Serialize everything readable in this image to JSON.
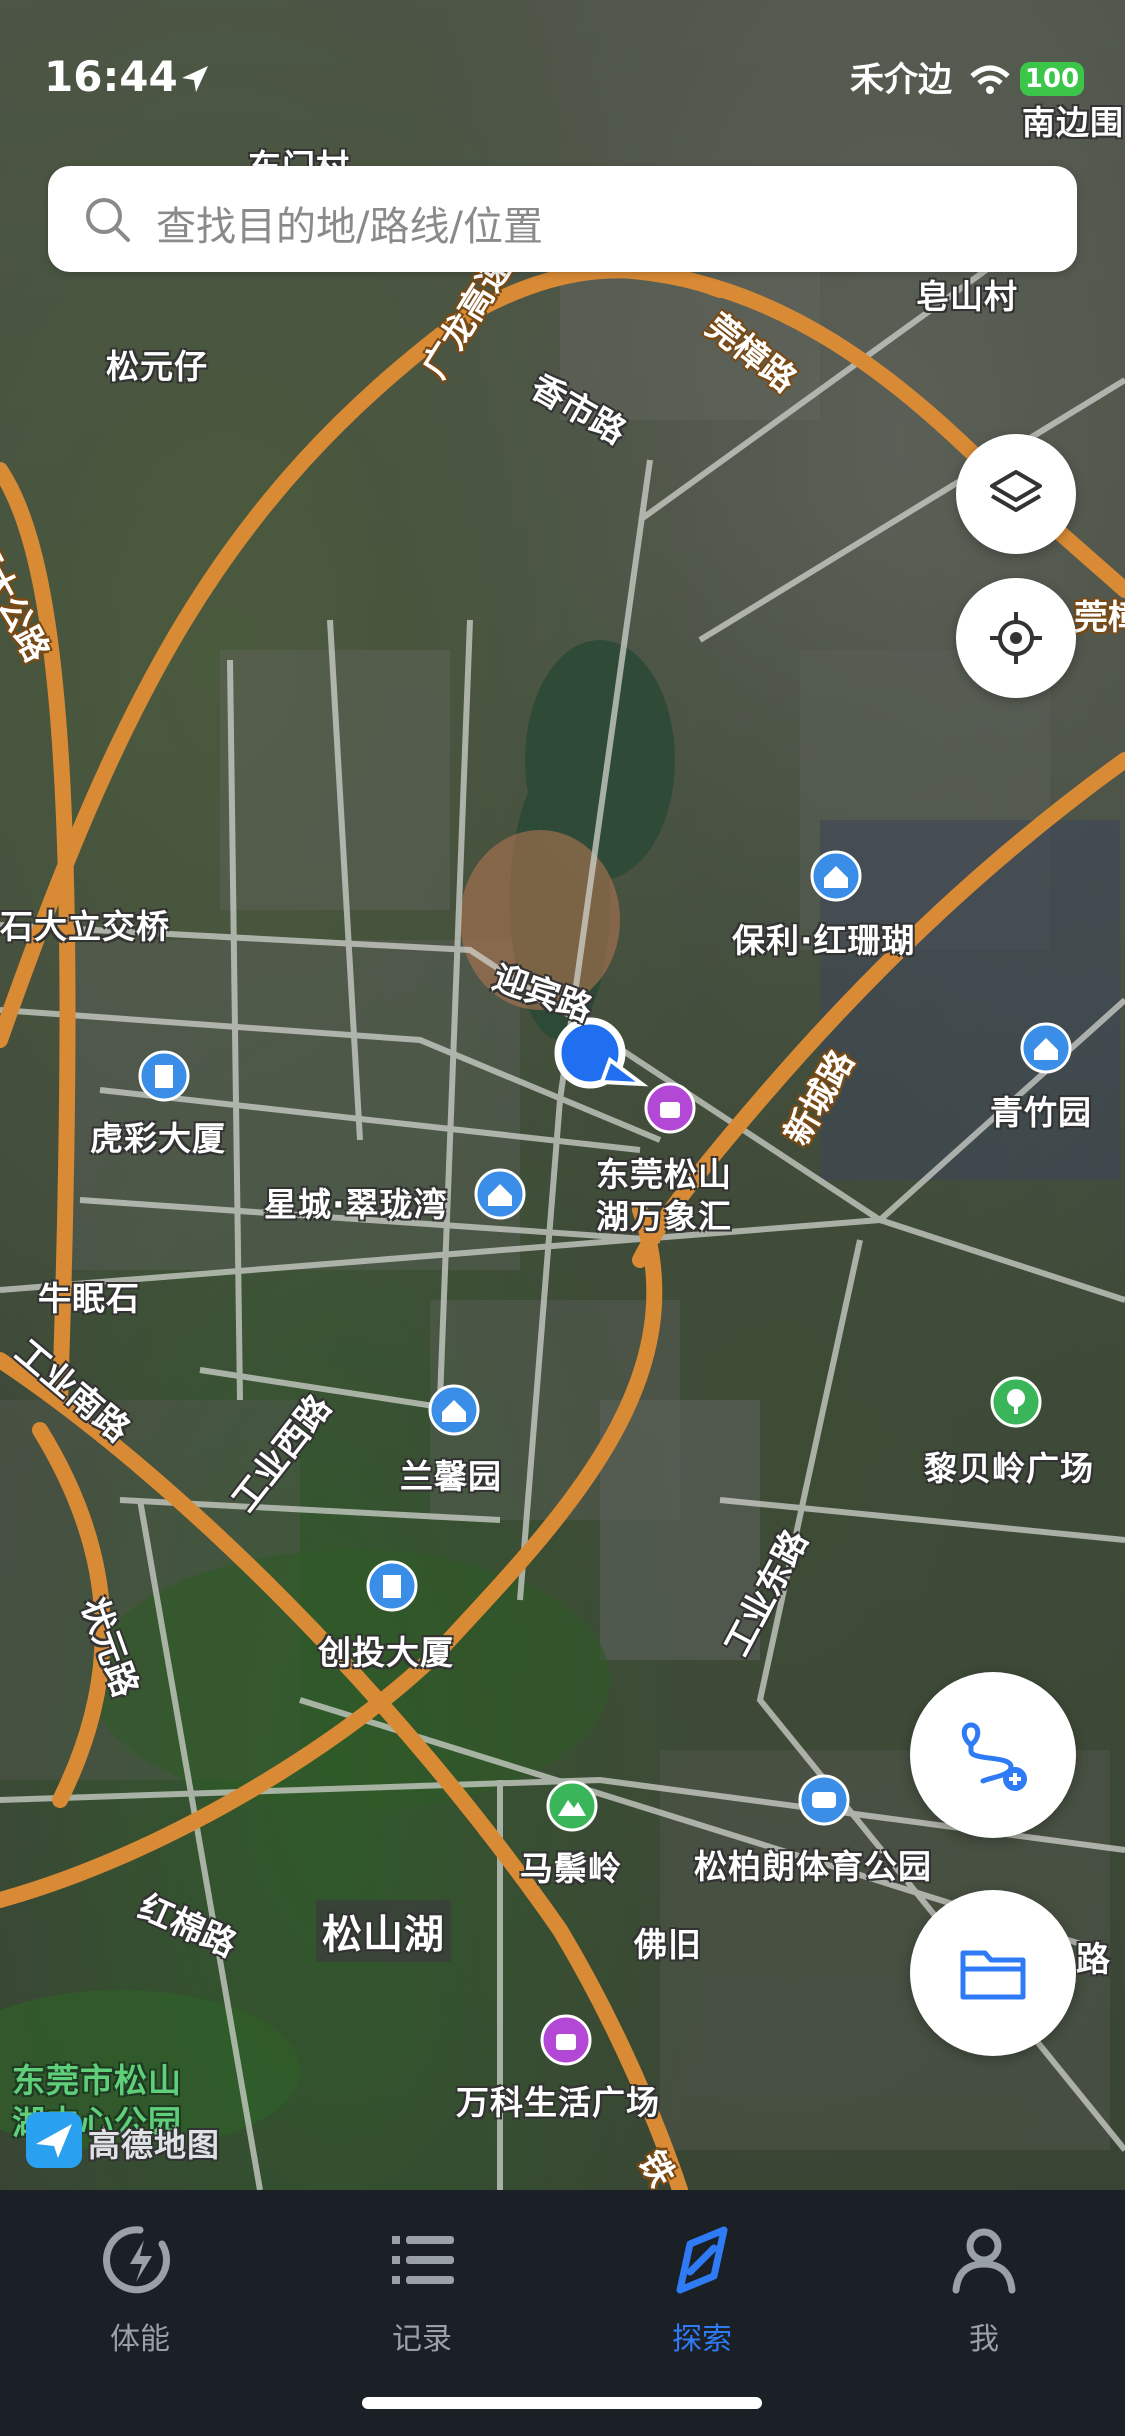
{
  "status_bar": {
    "time": "16:44",
    "carrier": "禾介边",
    "battery": "100"
  },
  "search": {
    "placeholder": "查找目的地/路线/位置"
  },
  "map": {
    "attribution": "高德地图",
    "area_labels": [
      "南边围",
      "东门村",
      "松元仔",
      "皂山村",
      "石大立交桥",
      "保利·红珊瑚",
      "虎彩大厦",
      "青竹园",
      "星城·翠珑湾",
      "东莞松山",
      "湖万象汇",
      "牛眠石",
      "兰馨园",
      "黎贝岭广场",
      "创投大厦",
      "马鬃岭",
      "松柏朗体育公园",
      "松山湖",
      "佛旧",
      "东莞市松山",
      "湖中心公园",
      "万科生活广场"
    ],
    "road_labels": [
      "莞樟路",
      "广龙高速",
      "香市路",
      "石大公路",
      "迎宾路",
      "新城路",
      "工业南路",
      "工业西路",
      "工业东路",
      "状元路",
      "红棉路",
      "莞樟",
      "路",
      "铁"
    ]
  },
  "tabs": [
    {
      "label": "体能",
      "icon": "lightning-circle-icon",
      "active": false
    },
    {
      "label": "记录",
      "icon": "list-icon",
      "active": false
    },
    {
      "label": "探索",
      "icon": "compass-icon",
      "active": true
    },
    {
      "label": "我",
      "icon": "person-icon",
      "active": false
    }
  ],
  "colors": {
    "accent": "#2f7bf5",
    "road_highway": "#d98a35",
    "tabbar_bg": "#1b1f26"
  }
}
